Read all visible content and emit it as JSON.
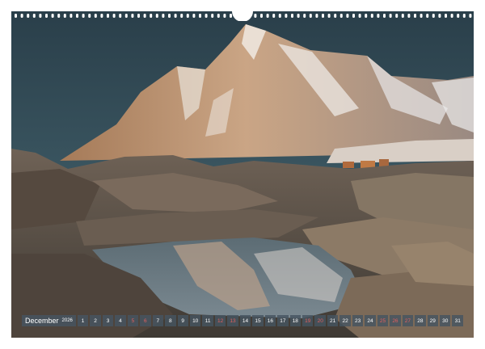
{
  "calendar": {
    "month": "December",
    "year": "2026",
    "days": [
      {
        "n": "1",
        "we": false
      },
      {
        "n": "2",
        "we": false
      },
      {
        "n": "3",
        "we": false
      },
      {
        "n": "4",
        "we": false
      },
      {
        "n": "5",
        "we": true
      },
      {
        "n": "6",
        "we": true
      },
      {
        "n": "7",
        "we": false
      },
      {
        "n": "8",
        "we": false
      },
      {
        "n": "9",
        "we": false
      },
      {
        "n": "10",
        "we": false
      },
      {
        "n": "11",
        "we": false
      },
      {
        "n": "12",
        "we": true
      },
      {
        "n": "13",
        "we": true
      },
      {
        "n": "14",
        "we": false
      },
      {
        "n": "15",
        "we": false
      },
      {
        "n": "16",
        "we": false
      },
      {
        "n": "17",
        "we": false
      },
      {
        "n": "18",
        "we": false
      },
      {
        "n": "19",
        "we": true
      },
      {
        "n": "20",
        "we": true
      },
      {
        "n": "21",
        "we": false
      },
      {
        "n": "22",
        "we": false
      },
      {
        "n": "23",
        "we": false
      },
      {
        "n": "24",
        "we": false
      },
      {
        "n": "25",
        "we": true
      },
      {
        "n": "26",
        "we": true
      },
      {
        "n": "27",
        "we": true
      },
      {
        "n": "28",
        "we": false
      },
      {
        "n": "29",
        "we": false
      },
      {
        "n": "30",
        "we": false
      },
      {
        "n": "31",
        "we": false
      }
    ]
  },
  "colors": {
    "weekend": "#e06060",
    "bar": "#465460",
    "sky": "#2f4650"
  }
}
